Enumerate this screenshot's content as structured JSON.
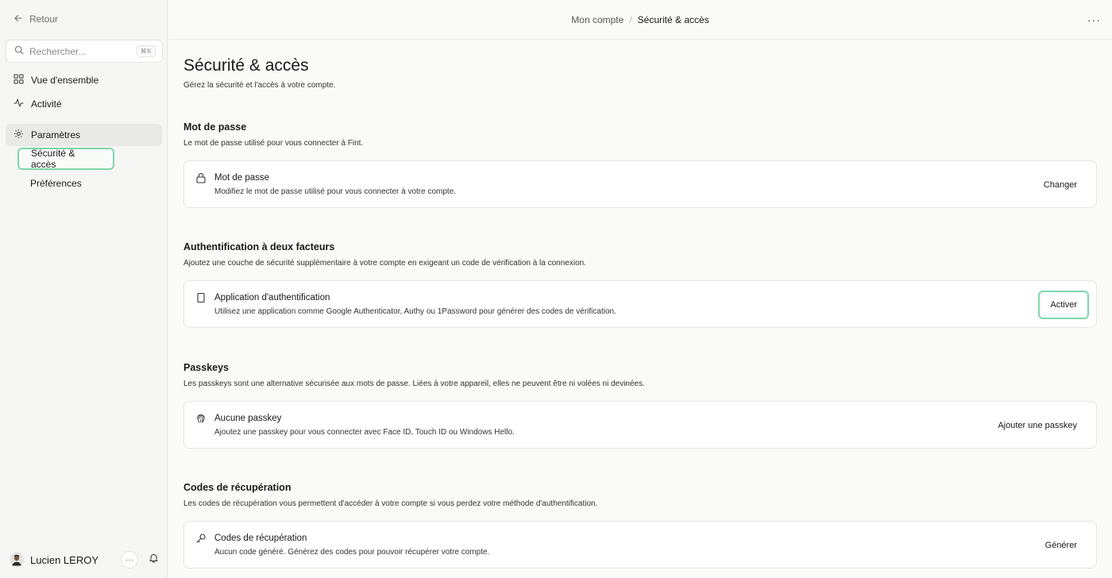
{
  "sidebar": {
    "back_label": "Retour",
    "search": {
      "placeholder": "Rechercher...",
      "shortcut": "⌘K"
    },
    "nav": {
      "overview": "Vue d'ensemble",
      "activity": "Activité",
      "settings": "Paramètres",
      "security": "Sécurité & accès",
      "preferences": "Préférences"
    },
    "user": {
      "name": "Lucien LEROY",
      "more": "···"
    }
  },
  "topbar": {
    "parent": "Mon compte",
    "separator": "/",
    "current": "Sécurité & accès",
    "more": "···"
  },
  "page": {
    "title": "Sécurité & accès",
    "subtitle": "Gérez la sécurité et l'accès à votre compte."
  },
  "sections": {
    "password": {
      "title": "Mot de passe",
      "description": "Le mot de passe utilisé pour vous connecter à Fint.",
      "card": {
        "title": "Mot de passe",
        "description": "Modifiez le mot de passe utilisé pour vous connecter à votre compte.",
        "action": "Changer",
        "icon": "lock-icon"
      }
    },
    "two_factor": {
      "title": "Authentification à deux facteurs",
      "description": "Ajoutez une couche de sécurité supplémentaire à votre compte en exigeant un code de vérification à la connexion.",
      "card": {
        "title": "Application d'authentification",
        "description": "Utilisez une application comme Google Authenticator, Authy ou 1Password pour générer des codes de vérification.",
        "action": "Activer",
        "icon": "smartphone-icon"
      }
    },
    "passkeys": {
      "title": "Passkeys",
      "description": "Les passkeys sont une alternative sécurisée aux mots de passe. Liées à votre appareil, elles ne peuvent être ni volées ni devinées.",
      "card": {
        "title": "Aucune passkey",
        "description": "Ajoutez une passkey pour vous connecter avec Face ID, Touch ID ou Windows Hello.",
        "action": "Ajouter une passkey",
        "icon": "fingerprint-icon"
      }
    },
    "recovery": {
      "title": "Codes de récupération",
      "description": "Les codes de récupération vous permettent d'accéder à votre compte si vous perdez votre méthode d'authentification.",
      "card": {
        "title": "Codes de récupération",
        "description": "Aucun code généré. Générez des codes pour pouvoir récupérer votre compte.",
        "action": "Générer",
        "icon": "key-icon"
      }
    }
  },
  "colors": {
    "highlight": "#7fd6ad",
    "sidebar_bg": "#f6f6f5",
    "main_bg": "#fafaf9",
    "active_nav_bg": "#e9e9e7"
  }
}
